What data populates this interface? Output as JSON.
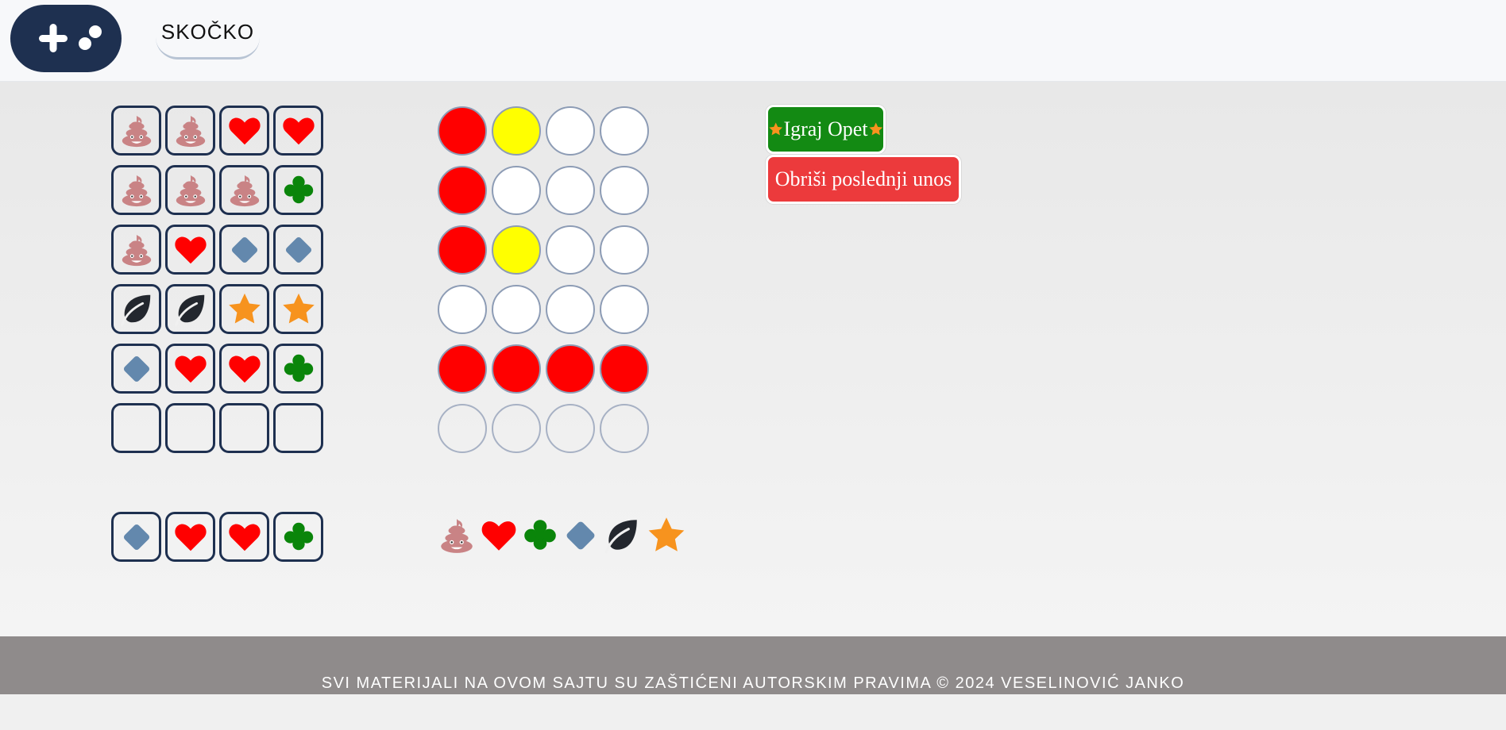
{
  "header": {
    "logo_icon": "gamepad-icon",
    "nav_tab_label": "SKOČKO"
  },
  "board": {
    "guesses": [
      [
        "poop",
        "poop",
        "heart",
        "heart"
      ],
      [
        "poop",
        "poop",
        "poop",
        "club"
      ],
      [
        "poop",
        "heart",
        "diamond",
        "diamond"
      ],
      [
        "leaf",
        "leaf",
        "star",
        "star"
      ],
      [
        "diamond",
        "heart",
        "heart",
        "club"
      ],
      [
        "",
        "",
        "",
        ""
      ]
    ],
    "feedback": [
      [
        "red",
        "yellow",
        "white",
        "white"
      ],
      [
        "red",
        "white",
        "white",
        "white"
      ],
      [
        "red",
        "yellow",
        "white",
        "white"
      ],
      [
        "white",
        "white",
        "white",
        "white"
      ],
      [
        "red",
        "red",
        "red",
        "red"
      ],
      [
        "empty",
        "empty",
        "empty",
        "empty"
      ]
    ],
    "solution": [
      "diamond",
      "heart",
      "heart",
      "club"
    ]
  },
  "palette": [
    "poop",
    "heart",
    "club",
    "diamond",
    "leaf",
    "star"
  ],
  "buttons": {
    "play_again_label": "Igraj Opet",
    "undo_label": "Obriši poslednji unos"
  },
  "footer": {
    "text": "SVI MATERIJALI NA OVOM SAJTU SU ZAŠTIĆENI AUTORSKIM PRAVIMA © 2024 VESELINOVIĆ JANKO"
  },
  "colors": {
    "peg_red": "#ff0000",
    "peg_yellow": "#ffff00",
    "peg_white": "#ffffff",
    "play_button": "#138a13",
    "undo_button": "#ec3a3c",
    "cell_border": "#1e3050"
  }
}
